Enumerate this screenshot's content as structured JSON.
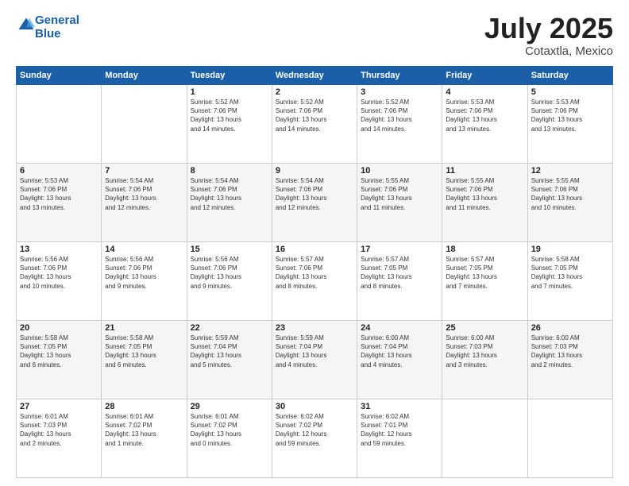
{
  "header": {
    "logo_line1": "General",
    "logo_line2": "Blue",
    "month_year": "July 2025",
    "location": "Cotaxtla, Mexico"
  },
  "weekdays": [
    "Sunday",
    "Monday",
    "Tuesday",
    "Wednesday",
    "Thursday",
    "Friday",
    "Saturday"
  ],
  "weeks": [
    [
      {
        "day": "",
        "info": ""
      },
      {
        "day": "",
        "info": ""
      },
      {
        "day": "1",
        "info": "Sunrise: 5:52 AM\nSunset: 7:06 PM\nDaylight: 13 hours\nand 14 minutes."
      },
      {
        "day": "2",
        "info": "Sunrise: 5:52 AM\nSunset: 7:06 PM\nDaylight: 13 hours\nand 14 minutes."
      },
      {
        "day": "3",
        "info": "Sunrise: 5:52 AM\nSunset: 7:06 PM\nDaylight: 13 hours\nand 14 minutes."
      },
      {
        "day": "4",
        "info": "Sunrise: 5:53 AM\nSunset: 7:06 PM\nDaylight: 13 hours\nand 13 minutes."
      },
      {
        "day": "5",
        "info": "Sunrise: 5:53 AM\nSunset: 7:06 PM\nDaylight: 13 hours\nand 13 minutes."
      }
    ],
    [
      {
        "day": "6",
        "info": "Sunrise: 5:53 AM\nSunset: 7:06 PM\nDaylight: 13 hours\nand 13 minutes."
      },
      {
        "day": "7",
        "info": "Sunrise: 5:54 AM\nSunset: 7:06 PM\nDaylight: 13 hours\nand 12 minutes."
      },
      {
        "day": "8",
        "info": "Sunrise: 5:54 AM\nSunset: 7:06 PM\nDaylight: 13 hours\nand 12 minutes."
      },
      {
        "day": "9",
        "info": "Sunrise: 5:54 AM\nSunset: 7:06 PM\nDaylight: 13 hours\nand 12 minutes."
      },
      {
        "day": "10",
        "info": "Sunrise: 5:55 AM\nSunset: 7:06 PM\nDaylight: 13 hours\nand 11 minutes."
      },
      {
        "day": "11",
        "info": "Sunrise: 5:55 AM\nSunset: 7:06 PM\nDaylight: 13 hours\nand 11 minutes."
      },
      {
        "day": "12",
        "info": "Sunrise: 5:55 AM\nSunset: 7:06 PM\nDaylight: 13 hours\nand 10 minutes."
      }
    ],
    [
      {
        "day": "13",
        "info": "Sunrise: 5:56 AM\nSunset: 7:06 PM\nDaylight: 13 hours\nand 10 minutes."
      },
      {
        "day": "14",
        "info": "Sunrise: 5:56 AM\nSunset: 7:06 PM\nDaylight: 13 hours\nand 9 minutes."
      },
      {
        "day": "15",
        "info": "Sunrise: 5:56 AM\nSunset: 7:06 PM\nDaylight: 13 hours\nand 9 minutes."
      },
      {
        "day": "16",
        "info": "Sunrise: 5:57 AM\nSunset: 7:06 PM\nDaylight: 13 hours\nand 8 minutes."
      },
      {
        "day": "17",
        "info": "Sunrise: 5:57 AM\nSunset: 7:05 PM\nDaylight: 13 hours\nand 8 minutes."
      },
      {
        "day": "18",
        "info": "Sunrise: 5:57 AM\nSunset: 7:05 PM\nDaylight: 13 hours\nand 7 minutes."
      },
      {
        "day": "19",
        "info": "Sunrise: 5:58 AM\nSunset: 7:05 PM\nDaylight: 13 hours\nand 7 minutes."
      }
    ],
    [
      {
        "day": "20",
        "info": "Sunrise: 5:58 AM\nSunset: 7:05 PM\nDaylight: 13 hours\nand 6 minutes."
      },
      {
        "day": "21",
        "info": "Sunrise: 5:58 AM\nSunset: 7:05 PM\nDaylight: 13 hours\nand 6 minutes."
      },
      {
        "day": "22",
        "info": "Sunrise: 5:59 AM\nSunset: 7:04 PM\nDaylight: 13 hours\nand 5 minutes."
      },
      {
        "day": "23",
        "info": "Sunrise: 5:59 AM\nSunset: 7:04 PM\nDaylight: 13 hours\nand 4 minutes."
      },
      {
        "day": "24",
        "info": "Sunrise: 6:00 AM\nSunset: 7:04 PM\nDaylight: 13 hours\nand 4 minutes."
      },
      {
        "day": "25",
        "info": "Sunrise: 6:00 AM\nSunset: 7:03 PM\nDaylight: 13 hours\nand 3 minutes."
      },
      {
        "day": "26",
        "info": "Sunrise: 6:00 AM\nSunset: 7:03 PM\nDaylight: 13 hours\nand 2 minutes."
      }
    ],
    [
      {
        "day": "27",
        "info": "Sunrise: 6:01 AM\nSunset: 7:03 PM\nDaylight: 13 hours\nand 2 minutes."
      },
      {
        "day": "28",
        "info": "Sunrise: 6:01 AM\nSunset: 7:02 PM\nDaylight: 13 hours\nand 1 minute."
      },
      {
        "day": "29",
        "info": "Sunrise: 6:01 AM\nSunset: 7:02 PM\nDaylight: 13 hours\nand 0 minutes."
      },
      {
        "day": "30",
        "info": "Sunrise: 6:02 AM\nSunset: 7:02 PM\nDaylight: 12 hours\nand 59 minutes."
      },
      {
        "day": "31",
        "info": "Sunrise: 6:02 AM\nSunset: 7:01 PM\nDaylight: 12 hours\nand 59 minutes."
      },
      {
        "day": "",
        "info": ""
      },
      {
        "day": "",
        "info": ""
      }
    ]
  ]
}
